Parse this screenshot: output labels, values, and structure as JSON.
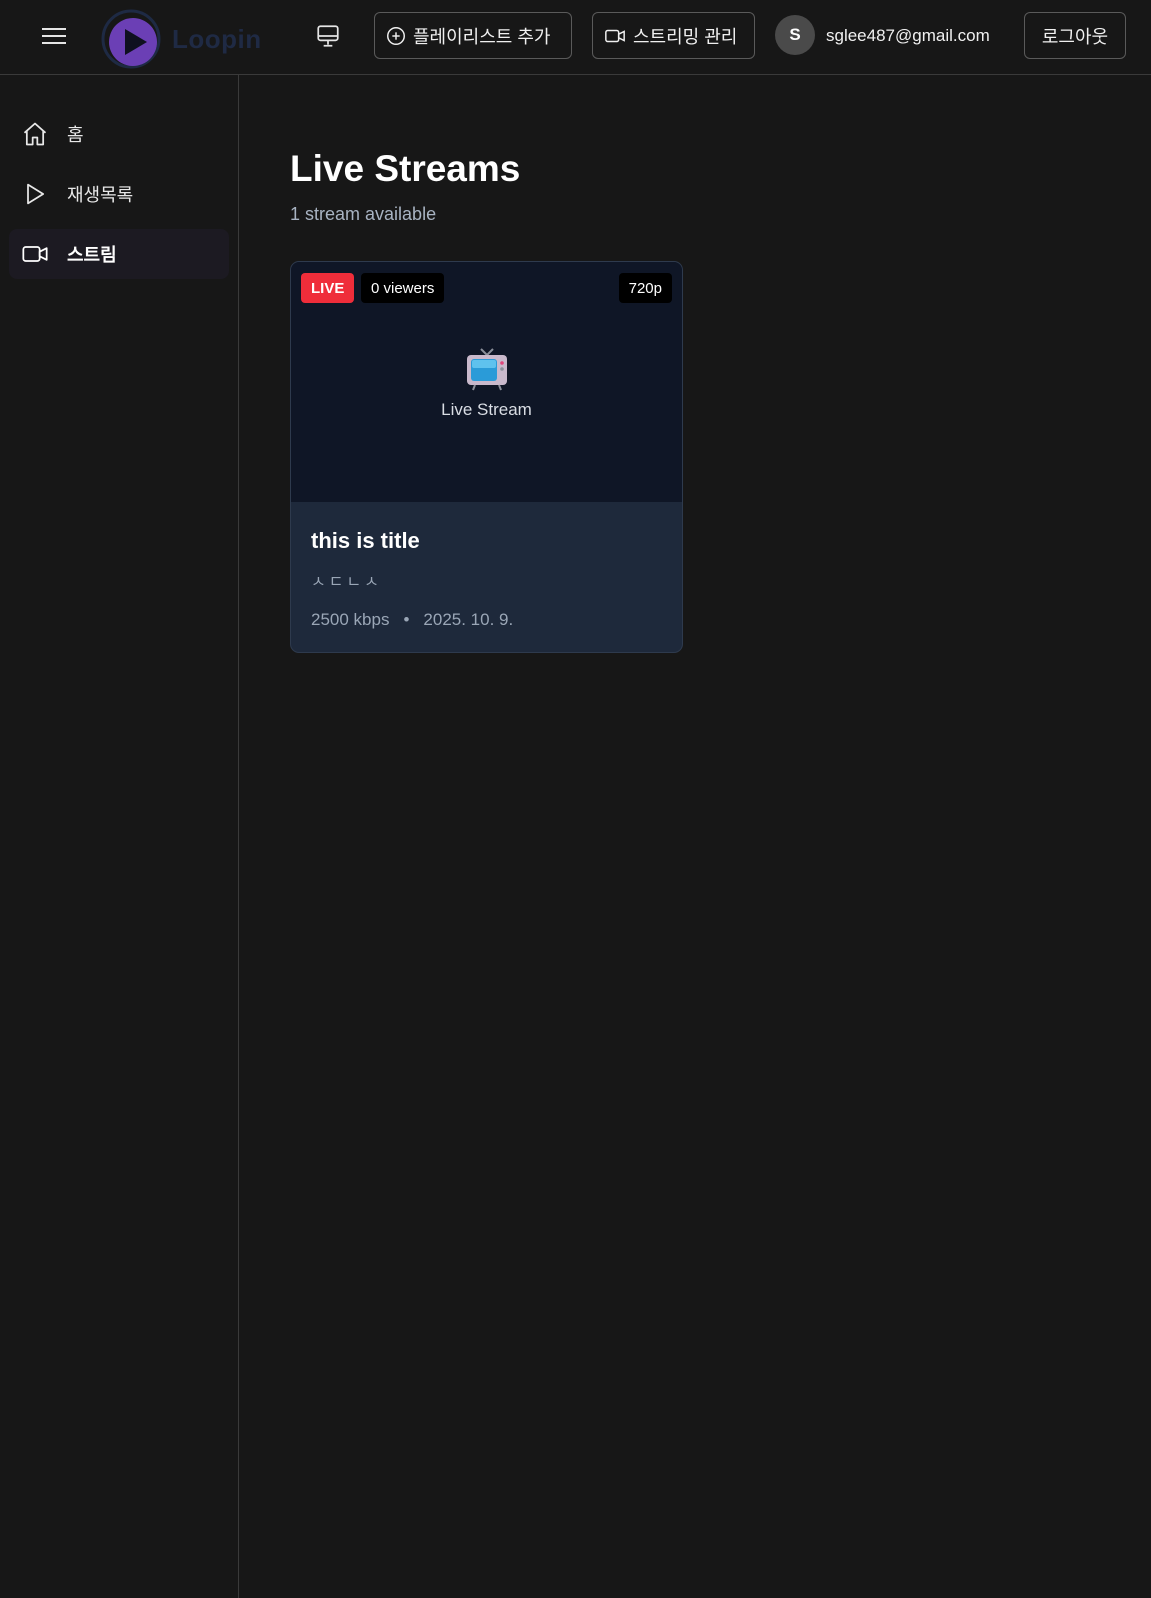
{
  "header": {
    "logo_text": "Loopin",
    "add_playlist_label": "플레이리스트 추가",
    "stream_manage_label": "스트리밍 관리",
    "avatar_initial": "S",
    "user_email": "sglee487@gmail.com",
    "logout_label": "로그아웃"
  },
  "sidebar": {
    "items": [
      {
        "label": "홈",
        "icon": "home-icon",
        "active": false
      },
      {
        "label": "재생목록",
        "icon": "play-icon",
        "active": false
      },
      {
        "label": "스트림",
        "icon": "video-camera-icon",
        "active": true
      }
    ]
  },
  "main": {
    "title": "Live Streams",
    "subtitle": "1 stream available"
  },
  "streams": [
    {
      "live_badge": "LIVE",
      "viewers": "0 viewers",
      "resolution": "720p",
      "thumb_label": "Live Stream",
      "title": "this is title",
      "description": "ㅅㄷㄴㅅ",
      "bitrate": "2500 kbps",
      "separator": "•",
      "date": "2025. 10. 9."
    }
  ],
  "colors": {
    "background": "#171717",
    "card": "#1e293b",
    "thumb": "#0f1626",
    "live_badge": "#ef2d3a",
    "logo_purple": "#6b3fb5"
  }
}
